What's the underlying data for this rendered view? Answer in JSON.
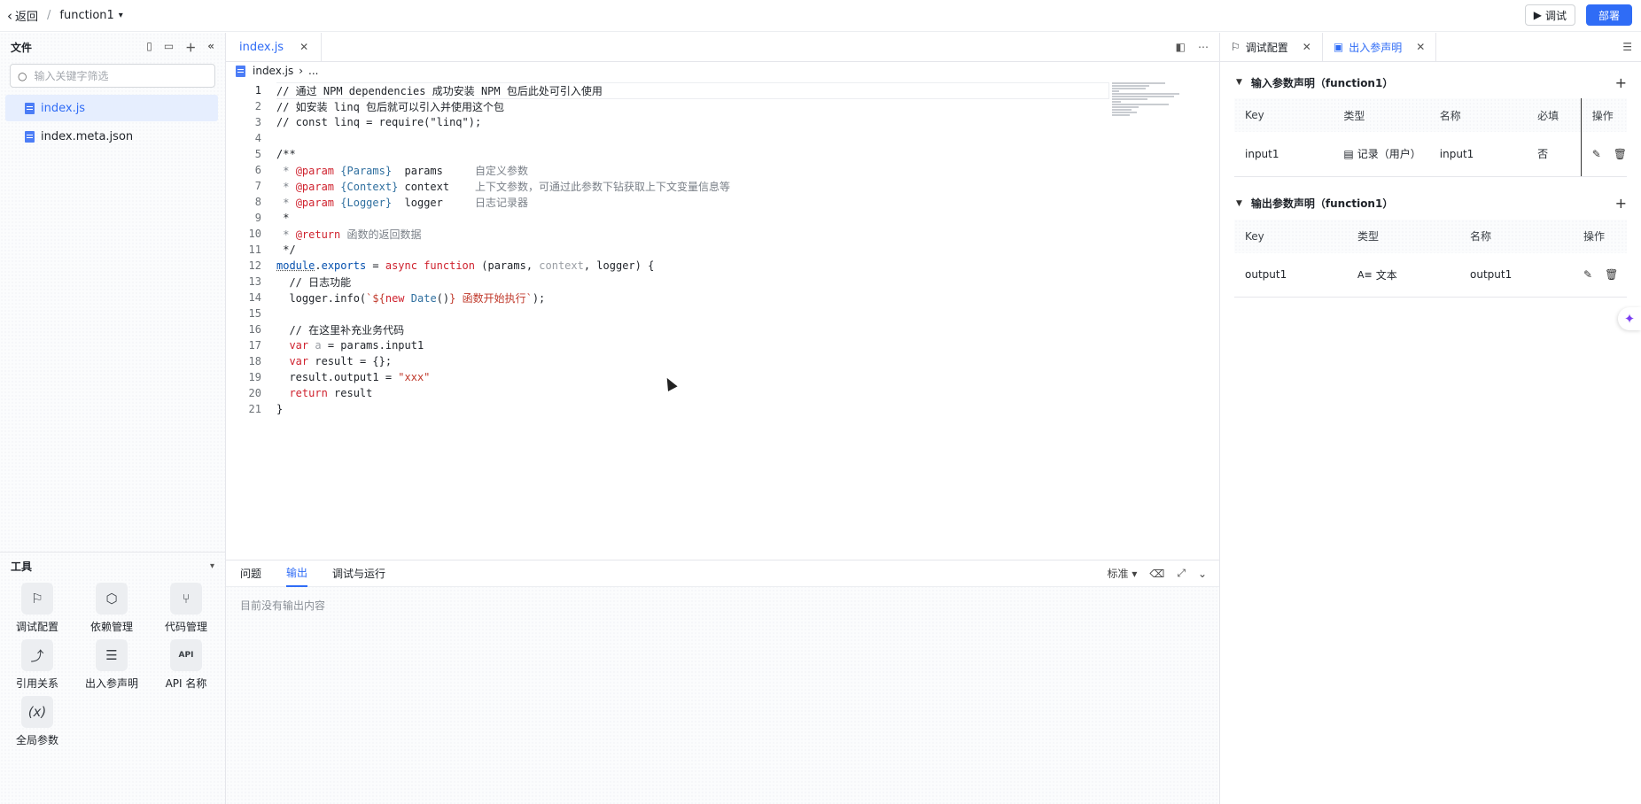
{
  "topbar": {
    "back_label": "返回",
    "separator": "/",
    "function_name": "function1",
    "debug_label": "调试",
    "deploy_label": "部署"
  },
  "left": {
    "files_title": "文件",
    "search_placeholder": "输入关键字筛选",
    "files": [
      "index.js",
      "index.meta.json"
    ],
    "tools_title": "工具",
    "tools": [
      {
        "label": "调试配置",
        "icon": "debug-config-icon"
      },
      {
        "label": "依赖管理",
        "icon": "package-icon"
      },
      {
        "label": "代码管理",
        "icon": "git-branch-icon"
      },
      {
        "label": "引用关系",
        "icon": "reference-icon"
      },
      {
        "label": "出入参声明",
        "icon": "params-icon"
      },
      {
        "label": "API 名称",
        "icon": "api-icon"
      },
      {
        "label": "全局参数",
        "icon": "variable-icon"
      }
    ]
  },
  "editor": {
    "tab": "index.js",
    "breadcrumb_file": "index.js",
    "breadcrumb_more": "...",
    "current_line": 1
  },
  "output": {
    "tabs": [
      "问题",
      "输出",
      "调试与运行"
    ],
    "active_tab": "输出",
    "level_label": "标准",
    "empty_text": "目前没有输出内容"
  },
  "right": {
    "tabs": [
      "调试配置",
      "出入参声明"
    ],
    "active_tab": "出入参声明",
    "input_section": {
      "title": "输入参数声明（function1）",
      "headers": [
        "Key",
        "类型",
        "名称",
        "必填",
        "操作"
      ],
      "rows": [
        {
          "key": "input1",
          "type": "记录（用户）",
          "name": "input1",
          "required": "否"
        }
      ]
    },
    "output_section": {
      "title": "输出参数声明（function1）",
      "headers": [
        "Key",
        "类型",
        "名称",
        "操作"
      ],
      "rows": [
        {
          "key": "output1",
          "type": "文本",
          "name": "output1"
        }
      ]
    }
  },
  "colors": {
    "accent": "#2f6cf6",
    "keyword": "#cf222e",
    "comment": "#7a8088",
    "type": "#2f6f9f"
  }
}
